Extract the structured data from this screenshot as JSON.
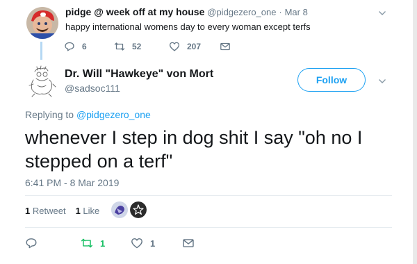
{
  "parent_tweet": {
    "display_name": "pidge @ week off at my house",
    "handle": "@pidgezero_one",
    "date_sep": "·",
    "date": "Mar 8",
    "text": "happy international womens day to every woman except terfs",
    "replies": "6",
    "retweets": "52",
    "likes": "207"
  },
  "tweet": {
    "display_name": "Dr. Will \"Hawkeye\" von Mort",
    "handle": "@sadsoc111",
    "follow_label": "Follow",
    "replying_prefix": "Replying to ",
    "replying_handle": "@pidgezero_one",
    "text": "whenever I step in dog shit I say \"oh no I stepped on a terf\"",
    "timestamp": "6:41 PM - 8 Mar 2019",
    "retweet_count": "1",
    "retweet_label": "Retweet",
    "like_count": "1",
    "like_label": "Like",
    "action_retweets": "1",
    "action_likes": "1"
  },
  "colors": {
    "link_blue": "#1da1f2",
    "retweet_green": "#17bf63",
    "muted_gray": "#657786",
    "text": "#14171a",
    "thread_line": "#b5d8f3"
  },
  "icons": {
    "reply": "speech-bubble",
    "retweet": "retweet-arrows",
    "like": "heart-outline",
    "message": "envelope",
    "more": "chevron-down"
  }
}
